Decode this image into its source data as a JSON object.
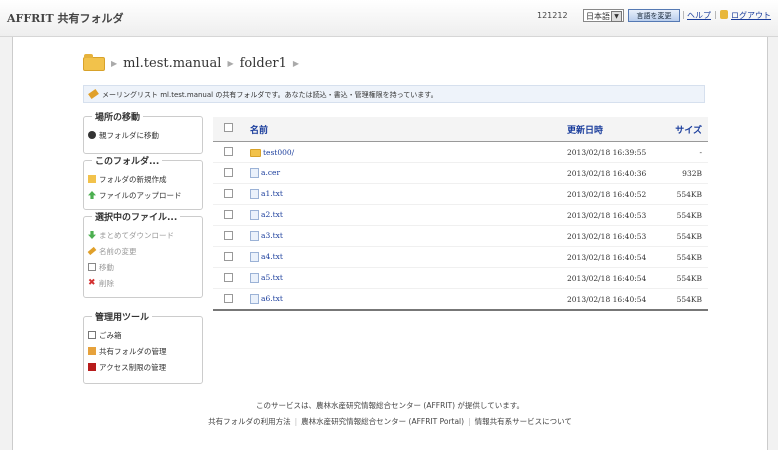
{
  "header": {
    "app_title": "AFFRIT 共有フォルダ",
    "user_id": "121212",
    "language": "日本語",
    "change_language": "言語を変更",
    "help": "ヘルプ",
    "logout": "ログアウト"
  },
  "breadcrumb": [
    "ml.test.manual",
    "folder1"
  ],
  "info_message": "メーリングリスト ml.test.manual の共有フォルダです。あなたは読込・書込・管理権限を持っています。",
  "sidebar": {
    "move": {
      "title": "場所の移動",
      "items": [
        "親フォルダに移動"
      ]
    },
    "this_folder": {
      "title": "このフォルダ...",
      "items": [
        "フォルダの新規作成",
        "ファイルのアップロード"
      ]
    },
    "selected": {
      "title": "選択中のファイル...",
      "items": [
        "まとめてダウンロード",
        "名前の変更",
        "移動",
        "削除"
      ]
    },
    "admin": {
      "title": "管理用ツール",
      "items": [
        "ごみ箱",
        "共有フォルダの管理",
        "アクセス制限の管理"
      ]
    }
  },
  "table": {
    "columns": {
      "name": "名前",
      "updated": "更新日時",
      "size": "サイズ"
    },
    "rows": [
      {
        "name": "test000/",
        "updated": "2013/02/18 16:39:55",
        "size": "-",
        "type": "folder"
      },
      {
        "name": "a.cer",
        "updated": "2013/02/18 16:40:36",
        "size": "932B",
        "type": "file"
      },
      {
        "name": "a1.txt",
        "updated": "2013/02/18 16:40:52",
        "size": "554KB",
        "type": "file"
      },
      {
        "name": "a2.txt",
        "updated": "2013/02/18 16:40:53",
        "size": "554KB",
        "type": "file"
      },
      {
        "name": "a3.txt",
        "updated": "2013/02/18 16:40:53",
        "size": "554KB",
        "type": "file"
      },
      {
        "name": "a4.txt",
        "updated": "2013/02/18 16:40:54",
        "size": "554KB",
        "type": "file"
      },
      {
        "name": "a5.txt",
        "updated": "2013/02/18 16:40:54",
        "size": "554KB",
        "type": "file"
      },
      {
        "name": "a6.txt",
        "updated": "2013/02/18 16:40:54",
        "size": "554KB",
        "type": "file"
      }
    ]
  },
  "footer": {
    "line1": "このサービスは、農林水産研究情報総合センター (AFFRIT) が提供しています。",
    "links": [
      "共有フォルダの利用方法",
      "農林水産研究情報総合センター (AFFRIT Portal)",
      "情報共有系サービスについて"
    ]
  }
}
